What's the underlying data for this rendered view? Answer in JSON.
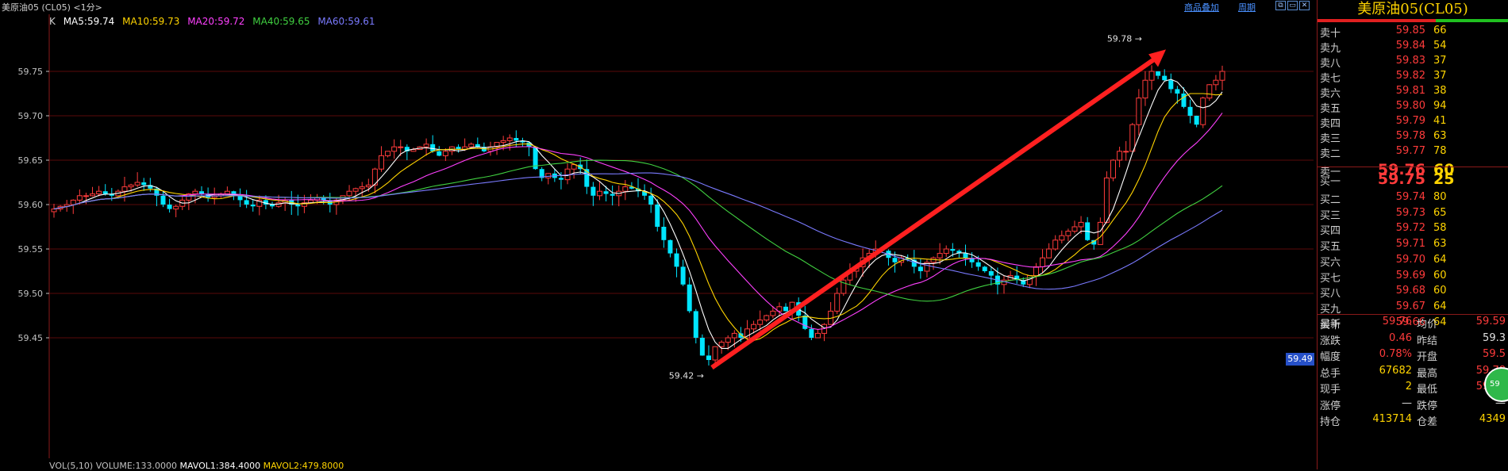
{
  "window": {
    "title": "美原油05 (CL05) <1分>",
    "link_overlay": "商品叠加",
    "link_period": "周期"
  },
  "legend": {
    "k": "K",
    "ma5": "MA5:59.74",
    "ma10": "MA10:59.73",
    "ma20": "MA20:59.72",
    "ma40": "MA40:59.65",
    "ma60": "MA60:59.61",
    "colors": {
      "ma5": "#ffffff",
      "ma10": "#ffd400",
      "ma20": "#ff40ff",
      "ma40": "#40d040",
      "ma60": "#7a7aff"
    }
  },
  "volume_legend": {
    "vol": "VOL(5,10)",
    "volume": "VOLUME:133.0000",
    "mavol1": "MAVOL1:384.4000",
    "mavol2": "MAVOL2:479.8000"
  },
  "current_price_tag": "59.49",
  "annotations": {
    "high": "59.78",
    "low": "59.42"
  },
  "chart_data": {
    "type": "candlestick",
    "ylim": [
      59.395,
      59.8
    ],
    "yticks": [
      "59.75",
      "59.70",
      "59.65",
      "59.60",
      "59.55",
      "59.50",
      "59.45"
    ],
    "grid": true,
    "candles_close": [
      59.595,
      59.598,
      59.6,
      59.605,
      59.61,
      59.61,
      59.612,
      59.615,
      59.612,
      59.61,
      59.615,
      59.62,
      59.622,
      59.625,
      59.622,
      59.618,
      59.61,
      59.6,
      59.595,
      59.598,
      59.605,
      59.612,
      59.615,
      59.612,
      59.608,
      59.61,
      59.612,
      59.615,
      59.61,
      59.605,
      59.6,
      59.598,
      59.605,
      59.6,
      59.598,
      59.602,
      59.605,
      59.6,
      59.598,
      59.602,
      59.605,
      59.608,
      59.605,
      59.6,
      59.605,
      59.61,
      59.615,
      59.618,
      59.62,
      59.622,
      59.64,
      59.655,
      59.66,
      59.665,
      59.665,
      59.66,
      59.662,
      59.665,
      59.668,
      59.66,
      59.655,
      59.66,
      59.665,
      59.662,
      59.665,
      59.668,
      59.665,
      59.66,
      59.665,
      59.67,
      59.672,
      59.675,
      59.672,
      59.67,
      59.665,
      59.64,
      59.63,
      59.635,
      59.63,
      59.628,
      59.64,
      59.645,
      59.64,
      59.62,
      59.61,
      59.615,
      59.612,
      59.61,
      59.615,
      59.62,
      59.618,
      59.615,
      59.61,
      59.6,
      59.575,
      59.56,
      59.545,
      59.53,
      59.51,
      59.48,
      59.45,
      59.43,
      59.425,
      59.44,
      59.445,
      59.45,
      59.455,
      59.45,
      59.46,
      59.465,
      59.47,
      59.475,
      59.48,
      59.485,
      59.48,
      59.49,
      59.475,
      59.46,
      59.45,
      59.455,
      59.465,
      59.48,
      59.5,
      59.515,
      59.525,
      59.53,
      59.54,
      59.545,
      59.55,
      59.548,
      59.54,
      59.535,
      59.54,
      59.538,
      59.53,
      59.525,
      59.535,
      59.54,
      59.545,
      59.55,
      59.548,
      59.545,
      59.54,
      59.535,
      59.53,
      59.525,
      59.52,
      59.51,
      59.515,
      59.52,
      59.515,
      59.51,
      59.52,
      59.53,
      59.54,
      59.55,
      59.56,
      59.565,
      59.57,
      59.575,
      59.58,
      59.56,
      59.555,
      59.58,
      59.63,
      59.65,
      59.66,
      59.66,
      59.69,
      59.72,
      59.74,
      59.75,
      59.745,
      59.74,
      59.73,
      59.725,
      59.71,
      59.7,
      59.69,
      59.72,
      59.735,
      59.74,
      59.75
    ]
  },
  "orderbook": {
    "title": "美原油05(CL05)",
    "asks": [
      {
        "label": "卖十",
        "price": "59.85",
        "vol": "66"
      },
      {
        "label": "卖九",
        "price": "59.84",
        "vol": "54"
      },
      {
        "label": "卖八",
        "price": "59.83",
        "vol": "37"
      },
      {
        "label": "卖七",
        "price": "59.82",
        "vol": "37"
      },
      {
        "label": "卖六",
        "price": "59.81",
        "vol": "38"
      },
      {
        "label": "卖五",
        "price": "59.80",
        "vol": "94"
      },
      {
        "label": "卖四",
        "price": "59.79",
        "vol": "41"
      },
      {
        "label": "卖三",
        "price": "59.78",
        "vol": "63"
      },
      {
        "label": "卖二",
        "price": "59.77",
        "vol": "78"
      },
      {
        "label": "卖一",
        "price": "59.76",
        "vol": "60"
      }
    ],
    "bids": [
      {
        "label": "买一",
        "price": "59.75",
        "vol": "25"
      },
      {
        "label": "买二",
        "price": "59.74",
        "vol": "80"
      },
      {
        "label": "买三",
        "price": "59.73",
        "vol": "65"
      },
      {
        "label": "买四",
        "price": "59.72",
        "vol": "58"
      },
      {
        "label": "买五",
        "price": "59.71",
        "vol": "63"
      },
      {
        "label": "买六",
        "price": "59.70",
        "vol": "64"
      },
      {
        "label": "买七",
        "price": "59.69",
        "vol": "60"
      },
      {
        "label": "买八",
        "price": "59.68",
        "vol": "60"
      },
      {
        "label": "买九",
        "price": "59.67",
        "vol": "64"
      },
      {
        "label": "买十",
        "price": "59.66",
        "vol": "64"
      }
    ]
  },
  "stats": [
    {
      "k1": "最新",
      "v1": "59.76",
      "c1": "red",
      "k2": "均价",
      "v2": "59.59",
      "c2": "red"
    },
    {
      "k1": "涨跌",
      "v1": "0.46",
      "c1": "red",
      "k2": "昨结",
      "v2": "59.3",
      "c2": "wht"
    },
    {
      "k1": "幅度",
      "v1": "0.78%",
      "c1": "red",
      "k2": "开盘",
      "v2": "59.5",
      "c2": "red"
    },
    {
      "k1": "总手",
      "v1": "67682",
      "c1": "yel",
      "k2": "最高",
      "v2": "59.78",
      "c2": "red"
    },
    {
      "k1": "现手",
      "v1": "2",
      "c1": "yel",
      "k2": "最低",
      "v2": "59.41",
      "c2": "red"
    },
    {
      "k1": "涨停",
      "v1": "—",
      "c1": "wht",
      "k2": "跌停",
      "v2": "—",
      "c2": "wht"
    },
    {
      "k1": "持仓",
      "v1": "413714",
      "c1": "yel",
      "k2": "仓差",
      "v2": "4349",
      "c2": "yel"
    }
  ],
  "float_badge": "59"
}
